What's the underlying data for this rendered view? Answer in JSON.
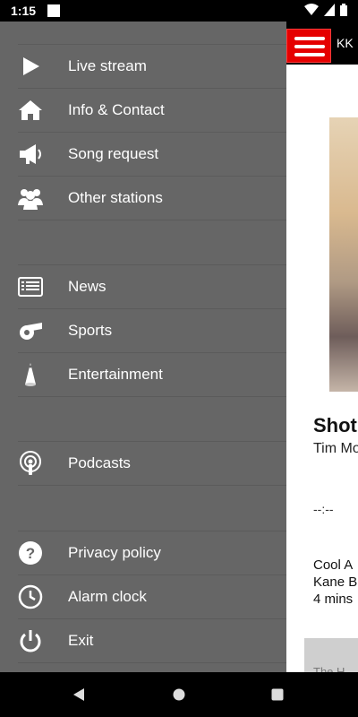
{
  "status_bar": {
    "time": "1:15",
    "icons": [
      "square-indicator-icon",
      "wifi-icon",
      "cell-signal-icon",
      "battery-icon"
    ]
  },
  "app": {
    "header_title": "KK",
    "accent_color": "#e50000",
    "drawer_color": "#666666"
  },
  "drawer": {
    "items": [
      {
        "label": "Live stream",
        "icon": "play-icon"
      },
      {
        "label": "Info & Contact",
        "icon": "home-icon"
      },
      {
        "label": "Song request",
        "icon": "megaphone-icon"
      },
      {
        "label": "Other stations",
        "icon": "people-icon"
      },
      {
        "label": "News",
        "icon": "news-icon"
      },
      {
        "label": "Sports",
        "icon": "whistle-icon"
      },
      {
        "label": "Entertainment",
        "icon": "spotlight-icon"
      },
      {
        "label": "Podcasts",
        "icon": "podcast-icon"
      },
      {
        "label": "Privacy policy",
        "icon": "help-icon"
      },
      {
        "label": "Alarm clock",
        "icon": "clock-icon"
      },
      {
        "label": "Exit",
        "icon": "power-icon"
      }
    ]
  },
  "now_playing": {
    "title": "Shot",
    "artist": "Tim Mo",
    "time": "--:--"
  },
  "next_up": {
    "title": "Cool A",
    "artist": "Kane B",
    "time": "4 mins"
  },
  "bottom_panel": {
    "text": "The H"
  },
  "nav_bar": {
    "buttons": [
      "back-icon",
      "home-icon",
      "recents-icon"
    ]
  }
}
